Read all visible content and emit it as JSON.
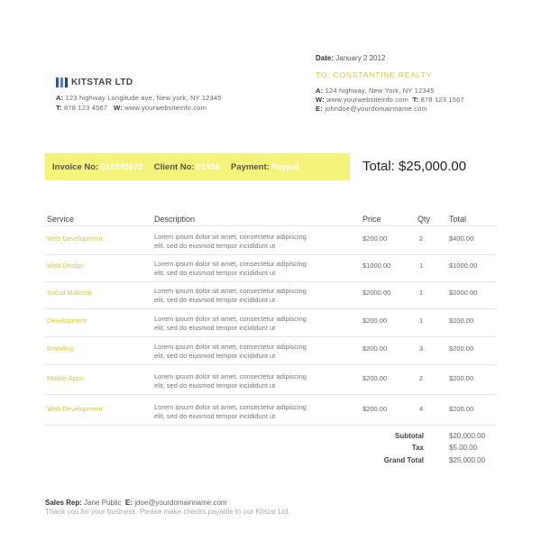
{
  "company": {
    "name": "KITSTAR LTD",
    "address_label": "A:",
    "address": "123 highway Longitude ave, New york, NY 12345",
    "tel_label": "T:",
    "tel": "878 123 4567",
    "web_label": "W:",
    "web": "www.yourwebsiteinfo.com"
  },
  "date": {
    "label": "Date:",
    "value": "January 2 2012"
  },
  "to": {
    "heading": "TO: CONSTANTINE REALTY",
    "address_label": "A:",
    "address": "124 highway, New York, NY 12345",
    "web_label": "W:",
    "web": "www.yourwebsiteinfo.com",
    "tel_label": "T:",
    "tel": "878 123 1567",
    "email_label": "E:",
    "email": "johndoe@yourdomainname.com"
  },
  "band": {
    "invoice_label": "Invoice No:",
    "invoice_value": "012345678",
    "client_label": "Client No:",
    "client_value": "81456",
    "payment_label": "Payment:",
    "payment_value": "Paypal"
  },
  "total_big": "Total: $25,000.00",
  "table": {
    "headers": {
      "service": "Service",
      "description": "Description",
      "price": "Price",
      "qty": "Qty",
      "total": "Total"
    },
    "rows": [
      {
        "service": "Web Development",
        "desc1": "Lorem ipsum dolor sit amet, consectetur adipiscing",
        "desc2": "elit, sed do eiusmod tempor incididunt ut",
        "price": "$200.00",
        "qty": "2",
        "total": "$400.00"
      },
      {
        "service": "Web Design",
        "desc1": "Lorem ipsum dolor sit amet, consectetur adipiscing",
        "desc2": "elit, sed do eiusmod tempor incididunt ut",
        "price": "$1000.00",
        "qty": "1",
        "total": "$1000.00"
      },
      {
        "service": "Social Material",
        "desc1": "Lorem ipsum dolor sit amet, consectetur adipiscing",
        "desc2": "elit, sed do eiusmod tempor incididunt ut",
        "price": "$2000.00",
        "qty": "1",
        "total": "$2000.00"
      },
      {
        "service": "Development",
        "desc1": "Lorem ipsum dolor sit amet, consectetur adipiscing",
        "desc2": "elit, sed do eiusmod tempor incididunt ut",
        "price": "$200.00",
        "qty": "1",
        "total": "$200.00"
      },
      {
        "service": "Branding",
        "desc1": "Lorem ipsum dolor sit amet, consectetur adipiscing",
        "desc2": "elit, sed do eiusmod tempor incididunt ut",
        "price": "$200.00",
        "qty": "3",
        "total": "$200.00"
      },
      {
        "service": "Mobile Apps",
        "desc1": "Lorem ipsum dolor sit amet, consectetur adipiscing",
        "desc2": "elit, sed do eiusmod tempor incididunt ut",
        "price": "$200.00",
        "qty": "2",
        "total": "$200.00"
      },
      {
        "service": "Web Development",
        "desc1": "Lorem ipsum dolor sit amet, consectetur adipiscing",
        "desc2": "elit, sed do eiusmod tempor incididunt ut",
        "price": "$200.00",
        "qty": "4",
        "total": "$200.00"
      }
    ]
  },
  "summary": {
    "subtotal_label": "Subtotal",
    "subtotal": "$20,000.00",
    "tax_label": "Tax",
    "tax": "$5.00.00",
    "grand_label": "Grand Total",
    "grand": "$25,000.00"
  },
  "footer": {
    "rep_label": "Sales Rep:",
    "rep_name": "Jane Public",
    "email_label": "E:",
    "email": "jdoe@yourdomainname.com",
    "thanks": "Thank you for your business. Please make checks payable to our Kitstar Ltd."
  },
  "colors": {
    "accent": "#d8c840",
    "band": "#f5f37a",
    "logo": "#2a56b8"
  }
}
